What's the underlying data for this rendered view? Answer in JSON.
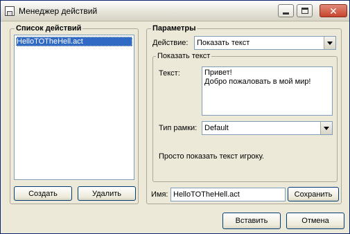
{
  "window": {
    "title": "Менеджер действий",
    "icon": "app-window-icon",
    "controls": {
      "minimize_icon": "minimize-icon",
      "maximize_icon": "maximize-icon",
      "close_icon": "close-icon",
      "close_glyph": "✕"
    }
  },
  "actions_group": {
    "title": "Список действий",
    "items": [
      {
        "label": "HelloTOTheHell.act",
        "selected": true
      }
    ],
    "create_label": "Создать",
    "delete_label": "Удалить"
  },
  "params_group": {
    "title": "Параметры",
    "action_label": "Действие:",
    "action_value": "Показать текст",
    "show_text_group": {
      "title": "Показать текст",
      "text_label": "Текст:",
      "text_line1": "Привет!",
      "text_line2": "Добро пожаловать в мой мир!",
      "frame_label": "Тип рамки:",
      "frame_value": "Default",
      "description": "Просто показать текст игроку."
    },
    "name_label": "Имя:",
    "name_value": "HelloTOTheHell.act",
    "save_label": "Сохранить"
  },
  "footer": {
    "insert_label": "Вставить",
    "cancel_label": "Отмена"
  },
  "colors": {
    "selection": "#316ac5",
    "face": "#ece9d8",
    "field_border": "#7f9db9"
  }
}
